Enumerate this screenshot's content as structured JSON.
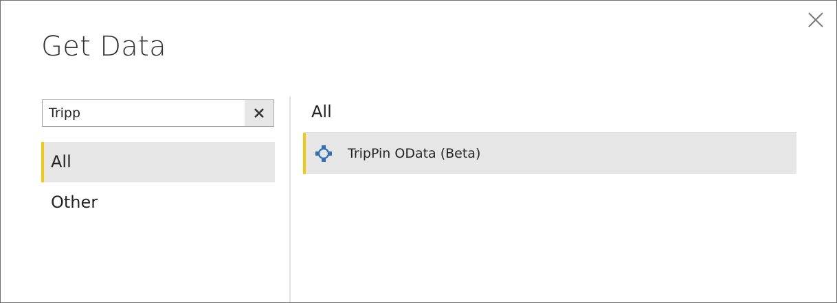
{
  "dialog": {
    "title": "Get Data",
    "close_icon": "close-icon"
  },
  "search": {
    "value": "Tripp",
    "placeholder": "",
    "clear_icon": "clear-search-icon"
  },
  "categories": [
    {
      "label": "All",
      "selected": true
    },
    {
      "label": "Other",
      "selected": false
    }
  ],
  "results": {
    "heading": "All",
    "items": [
      {
        "label": "TripPin OData (Beta)",
        "icon": "odata-connector-icon",
        "selected": true
      }
    ]
  },
  "colors": {
    "accent": "#f2c811",
    "selection_bg": "#e6e6e6",
    "icon_blue": "#2f6fb5",
    "border": "#a6a6a6"
  }
}
